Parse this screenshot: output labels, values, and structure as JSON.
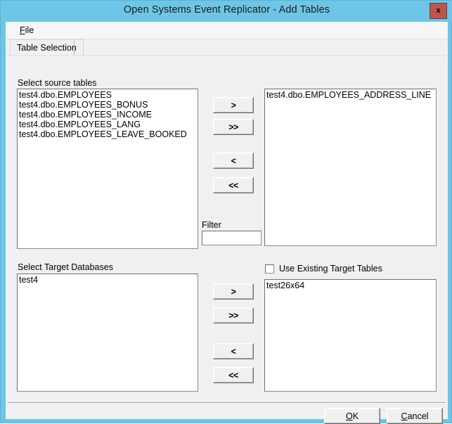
{
  "window": {
    "title": "Open Systems Event Replicator - Add Tables",
    "close_label": "x",
    "titlebar_color": "#6ec6e6",
    "close_color": "#c0554d"
  },
  "menu": {
    "file": {
      "prefix": "",
      "accel": "F",
      "rest": "ile"
    }
  },
  "tabs": [
    {
      "label": "Table Selection",
      "selected": true
    }
  ],
  "source_section": {
    "label": "Select source tables",
    "items": [
      "test4.dbo.EMPLOYEES",
      "test4.dbo.EMPLOYEES_BONUS",
      "test4.dbo.EMPLOYEES_INCOME",
      "test4.dbo.EMPLOYEES_LANG",
      "test4.dbo.EMPLOYEES_LEAVE_BOOKED"
    ]
  },
  "top_transfer_buttons": [
    {
      "label": ">",
      "name": "move-right-button"
    },
    {
      "label": ">>",
      "name": "move-all-right-button"
    },
    {
      "label": "<",
      "name": "move-left-button"
    },
    {
      "label": "<<",
      "name": "move-all-left-button"
    }
  ],
  "filter": {
    "label": "Filter",
    "value": "",
    "placeholder": ""
  },
  "selected_tables": {
    "items": [
      "test4.dbo.EMPLOYEES_ADDRESS_LINE"
    ]
  },
  "target_db_section": {
    "label": "Select Target Databases",
    "items": [
      "test4"
    ]
  },
  "bottom_transfer_buttons": [
    {
      "label": ">",
      "name": "db-move-right-button"
    },
    {
      "label": ">>",
      "name": "db-move-all-right-button"
    },
    {
      "label": "<",
      "name": "db-move-left-button"
    },
    {
      "label": "<<",
      "name": "db-move-all-left-button"
    }
  ],
  "use_existing": {
    "label": "Use Existing Target Tables",
    "checked": false
  },
  "selected_databases": {
    "items": [
      "test26x64"
    ]
  },
  "footer": {
    "ok": {
      "accel": "O",
      "before": "",
      "after": "K"
    },
    "cancel": {
      "accel": "C",
      "before": "",
      "after": "ancel"
    }
  }
}
